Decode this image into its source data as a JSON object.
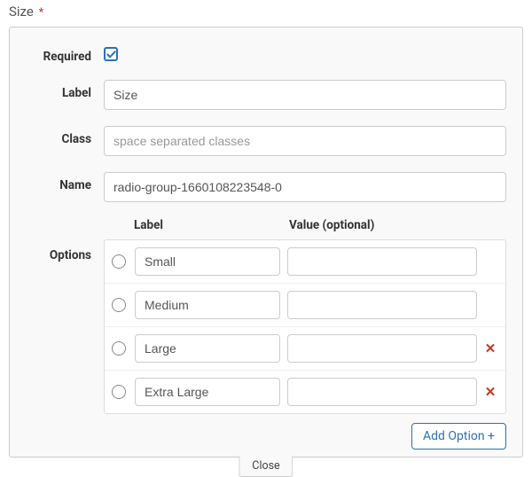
{
  "header": {
    "title": "Size",
    "required_mark": "*"
  },
  "fields": {
    "required": {
      "label": "Required",
      "checked": true
    },
    "label": {
      "label": "Label",
      "value": "Size"
    },
    "class": {
      "label": "Class",
      "value": "",
      "placeholder": "space separated classes"
    },
    "name": {
      "label": "Name",
      "value": "radio-group-1660108223548-0"
    }
  },
  "options_section": {
    "label": "Options",
    "header_label": "Label",
    "header_value": "Value (optional)",
    "rows": [
      {
        "label": "Small",
        "value": "",
        "removable": false
      },
      {
        "label": "Medium",
        "value": "",
        "removable": false
      },
      {
        "label": "Large",
        "value": "",
        "removable": true
      },
      {
        "label": "Extra Large",
        "value": "",
        "removable": true
      }
    ],
    "add_button": "Add Option +"
  },
  "footer": {
    "close": "Close"
  }
}
